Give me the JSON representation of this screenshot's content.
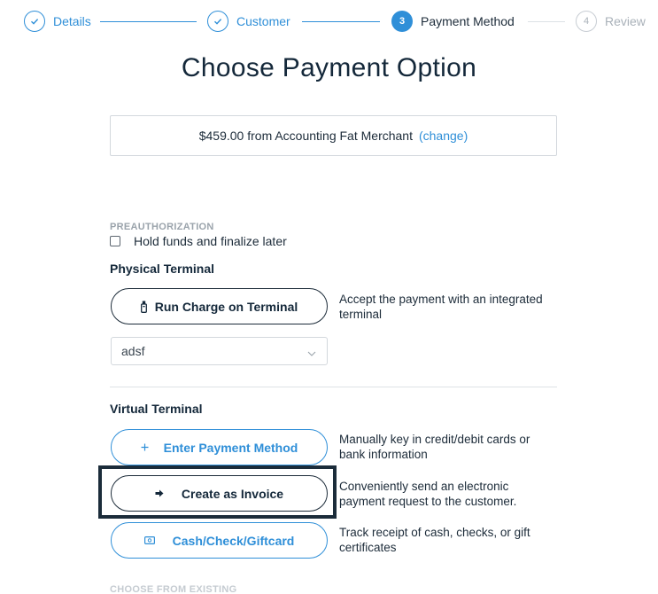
{
  "stepper": {
    "steps": [
      {
        "number": "",
        "label": "Details",
        "state": "done"
      },
      {
        "number": "",
        "label": "Customer",
        "state": "done"
      },
      {
        "number": "3",
        "label": "Payment Method",
        "state": "active"
      },
      {
        "number": "4",
        "label": "Review",
        "state": "todo"
      }
    ]
  },
  "title": "Choose Payment Option",
  "summary": {
    "text": "$459.00 from Accounting Fat Merchant",
    "change_link": "(change)"
  },
  "preauthorization": {
    "heading": "PREAUTHORIZATION",
    "checkbox_label": "Hold funds and finalize later",
    "checked": false
  },
  "physical_terminal": {
    "heading": "Physical Terminal",
    "button_label": "Run Charge on Terminal",
    "button_icon": "terminal-icon",
    "description": "Accept the payment with an integrated terminal",
    "terminal_select_value": "adsf"
  },
  "virtual_terminal": {
    "heading": "Virtual Terminal",
    "options": [
      {
        "label": "Enter Payment Method",
        "icon": "plus-icon",
        "description": "Manually key in credit/debit cards or bank information"
      },
      {
        "label": "Create as Invoice",
        "icon": "arrow-right-icon",
        "description": "Conveniently send an electronic payment request to the customer."
      },
      {
        "label": "Cash/Check/Giftcard",
        "icon": "cash-icon",
        "description": "Track receipt of cash, checks, or gift certificates"
      }
    ]
  },
  "existing": {
    "heading": "CHOOSE FROM EXISTING"
  },
  "colors": {
    "accent": "#2f8fd8",
    "text_dark": "#14283a",
    "focus_outline": "#1b2c3a"
  }
}
